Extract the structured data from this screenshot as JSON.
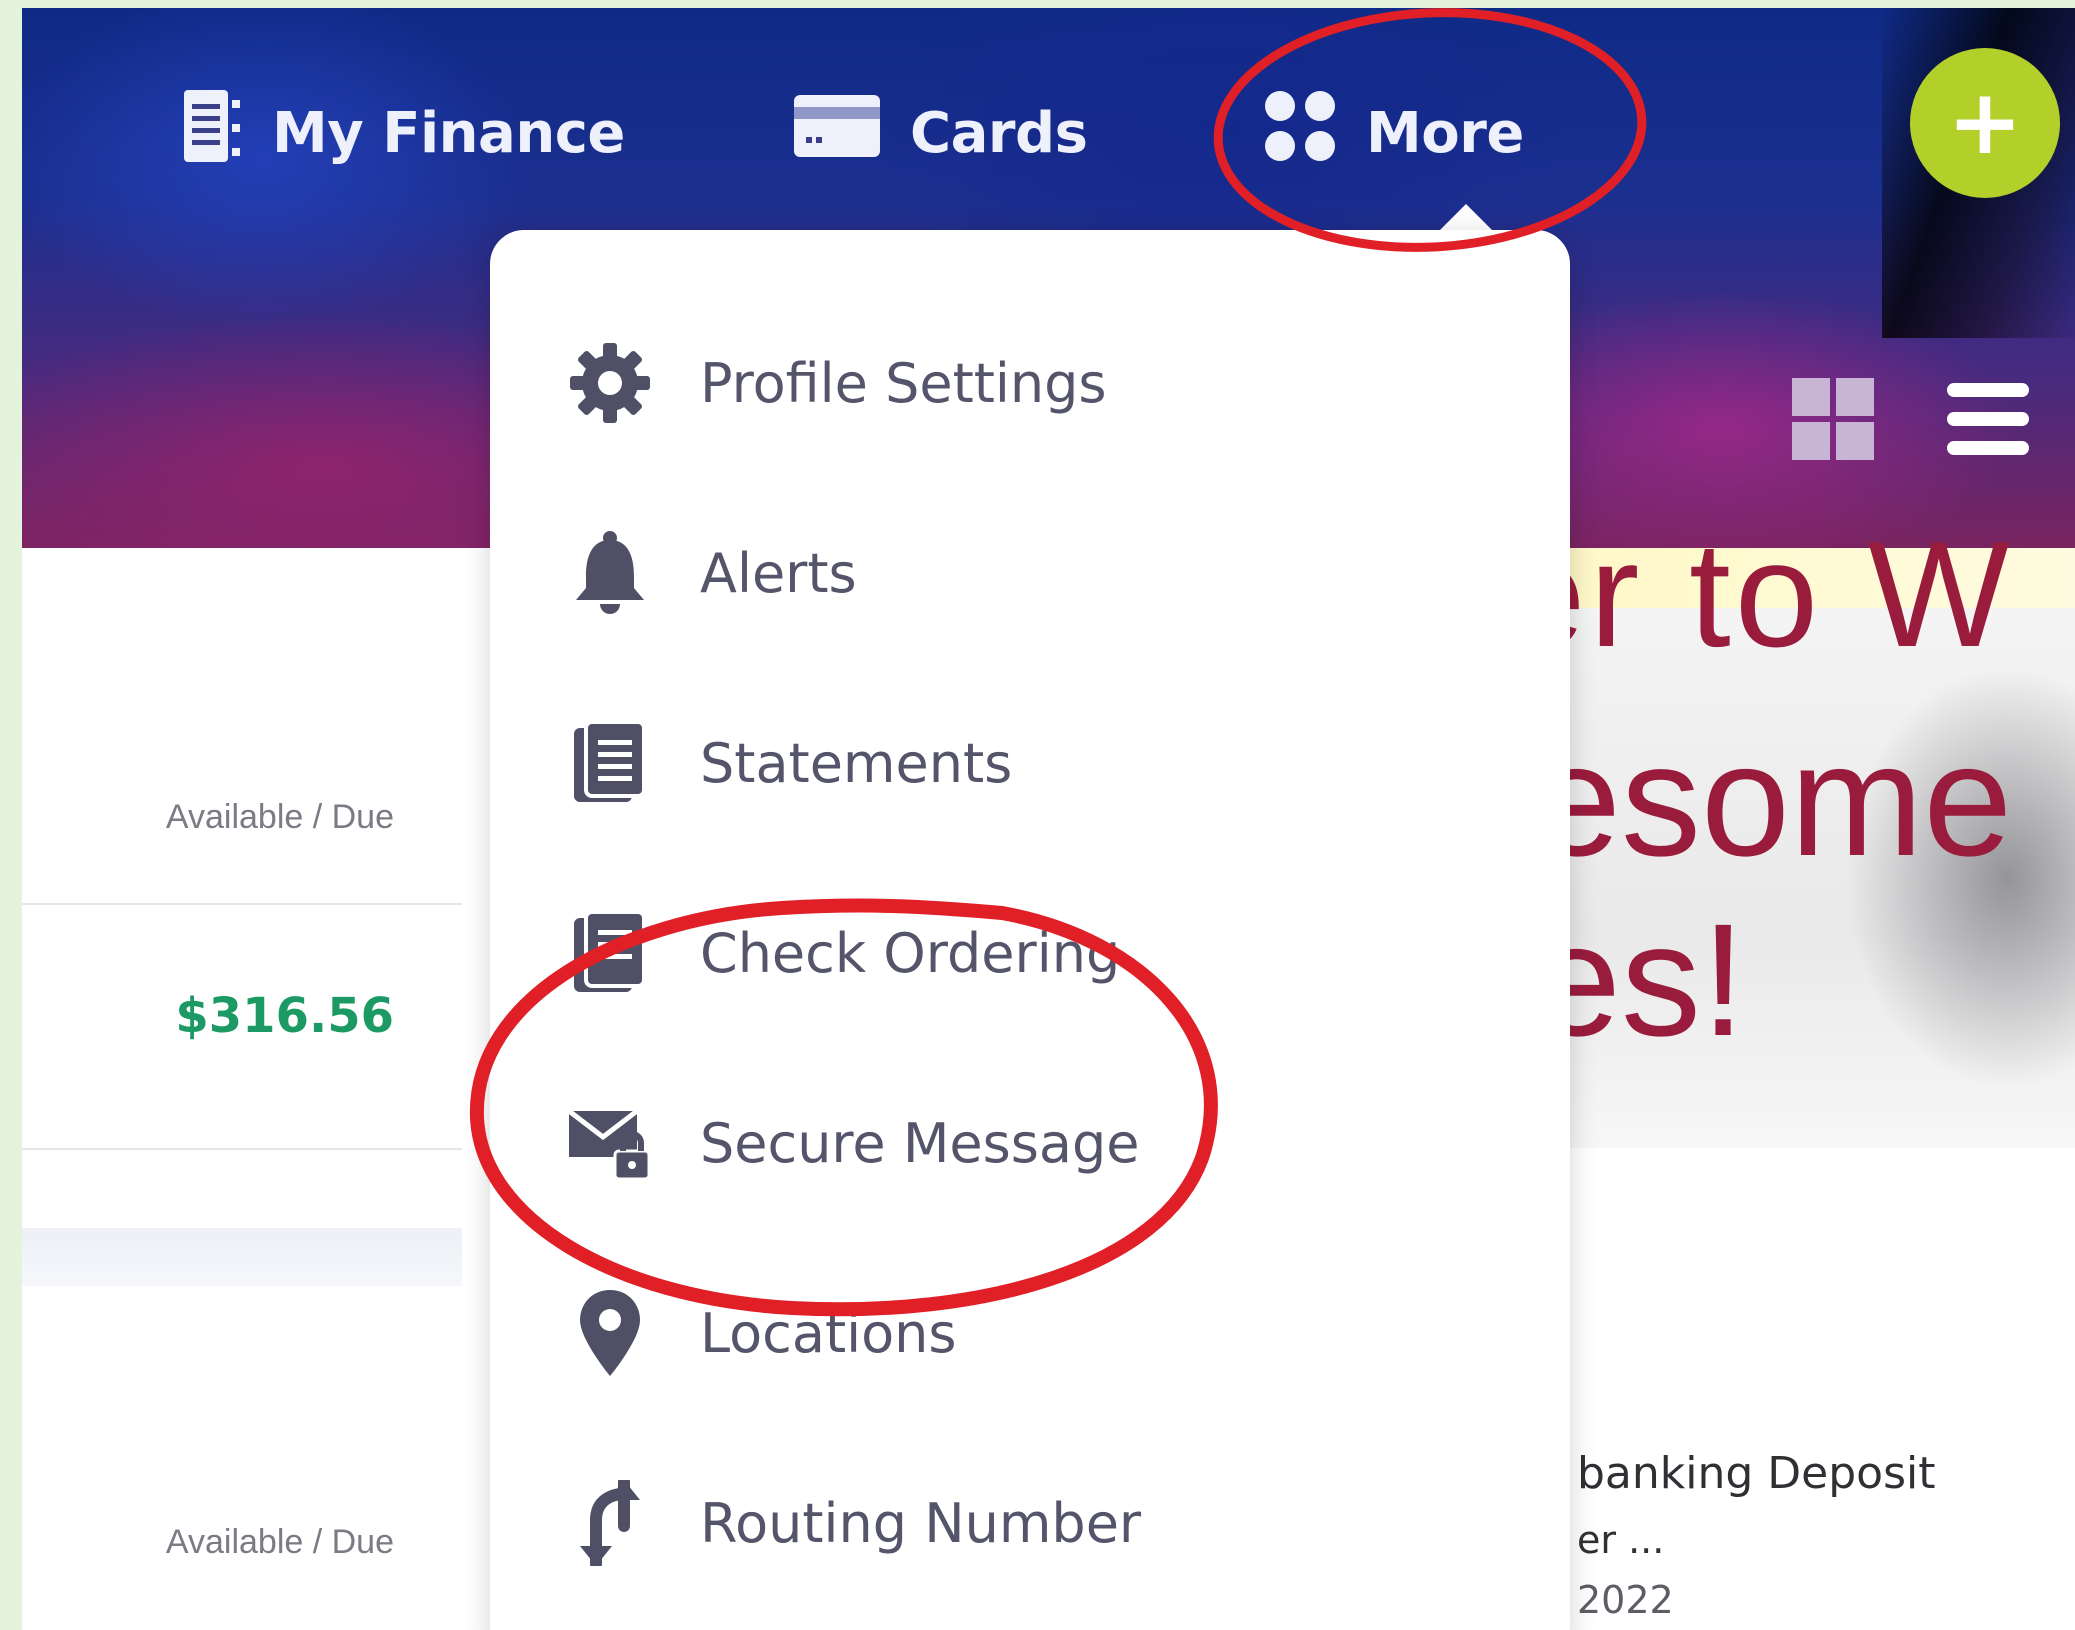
{
  "nav": {
    "items": [
      {
        "label": "My Finance",
        "icon": "ledger-icon"
      },
      {
        "label": "Cards",
        "icon": "card-icon"
      },
      {
        "label": "More",
        "icon": "dots-grid-icon"
      }
    ],
    "fab_label": "+"
  },
  "menu": {
    "items": [
      {
        "label": "Profile Settings",
        "icon": "gear-icon"
      },
      {
        "label": "Alerts",
        "icon": "bell-icon"
      },
      {
        "label": "Statements",
        "icon": "document-icon"
      },
      {
        "label": "Check Ordering",
        "icon": "check-document-icon"
      },
      {
        "label": "Secure Message",
        "icon": "lock-envelope-icon"
      },
      {
        "label": "Locations",
        "icon": "map-pin-icon"
      },
      {
        "label": "Routing Number",
        "icon": "exchange-arrows-icon"
      }
    ]
  },
  "accounts": {
    "available_label_1": "Available / Due",
    "amount_1": "$316.56",
    "available_label_2": "Available / Due"
  },
  "promo": {
    "line1": "er to W",
    "line2": "esome",
    "line3": "es!"
  },
  "news": {
    "title": "banking Deposit",
    "subtitle": "er ...",
    "date": "2022"
  },
  "colors": {
    "accent_green": "#b3cf2a",
    "amount_green": "#1d9a64",
    "annotation_red": "#e01f26",
    "promo_red": "#9a1c3c"
  }
}
